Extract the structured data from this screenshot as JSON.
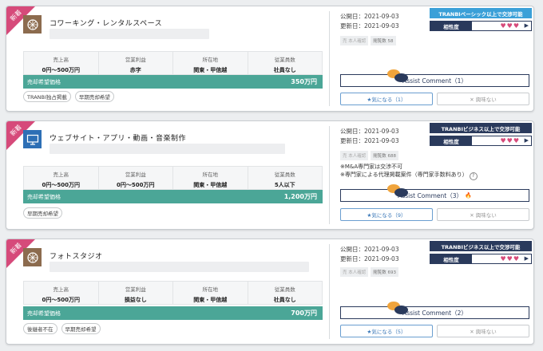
{
  "colors": {
    "new_ribbon": "#d64a7a",
    "price_bar": "#4ba697",
    "navy": "#2a3a5c",
    "basic_badge": "#3aa0d8",
    "fav_blue": "#3b78b8"
  },
  "listings": [
    {
      "ribbon": "新着",
      "icon": "coworking-icon",
      "title": "コワーキング・レンタルスペース",
      "stats": [
        {
          "label": "売上高",
          "value": "0円〜500万円"
        },
        {
          "label": "営業利益",
          "value": "赤字"
        },
        {
          "label": "所在地",
          "value": "関東・甲信越"
        },
        {
          "label": "従業員数",
          "value": "社員なし"
        }
      ],
      "price_label": "売却希望価格",
      "price_value": "350万円",
      "tags": [
        "TRANBI独占掲載",
        "早期売却希望"
      ],
      "published": "公開日：2021-09-03",
      "updated": "更新日：2021-09-03",
      "plan_badge": "TRANBIベーシック以上で交渉可能",
      "compat_label": "相性度",
      "compat_hearts": "♥♥♥",
      "mini_tags": [
        "売 本人確認",
        "閲覧数 58"
      ],
      "notes": [],
      "assist_label": "Assist Comment",
      "assist_count": "（1）",
      "assist_hot": false,
      "fav_label": "★気になる（1）",
      "no_label": "✕ 興味ない"
    },
    {
      "ribbon": "新着",
      "icon": "monitor-icon",
      "title": "ウェブサイト・アプリ・動画・音楽制作",
      "stats": [
        {
          "label": "売上高",
          "value": "0円〜500万円"
        },
        {
          "label": "営業利益",
          "value": "0円〜500万円"
        },
        {
          "label": "所在地",
          "value": "関東・甲信越"
        },
        {
          "label": "従業員数",
          "value": "5人以下"
        }
      ],
      "price_label": "売却希望価格",
      "price_value": "1,200万円",
      "tags": [
        "早期売却希望"
      ],
      "published": "公開日：2021-09-03",
      "updated": "更新日：2021-09-03",
      "plan_badge": "TRANBIビジネス以上で交渉可能",
      "compat_label": "相性度",
      "compat_hearts": "♥♥♥",
      "mini_tags": [
        "売 本人確認",
        "閲覧数 688"
      ],
      "notes": [
        "※M&A専門家は交渉不可",
        "※専門家による代理掲載案件（専門家手数料あり）"
      ],
      "assist_label": "Assist Comment",
      "assist_count": "（3）",
      "assist_hot": true,
      "fav_label": "★気になる（9）",
      "no_label": "✕ 興味ない"
    },
    {
      "ribbon": "新着",
      "icon": "photo-studio-icon",
      "title": "フォトスタジオ",
      "stats": [
        {
          "label": "売上高",
          "value": "0円〜500万円"
        },
        {
          "label": "営業利益",
          "value": "損益なし"
        },
        {
          "label": "所在地",
          "value": "関東・甲信越"
        },
        {
          "label": "従業員数",
          "value": "社員なし"
        }
      ],
      "price_label": "売却希望価格",
      "price_value": "700万円",
      "tags": [
        "後継者不在",
        "早期売却希望"
      ],
      "published": "公開日：2021-09-03",
      "updated": "更新日：2021-09-03",
      "plan_badge": "TRANBIビジネス以上で交渉可能",
      "compat_label": "相性度",
      "compat_hearts": "♥♥♥",
      "mini_tags": [
        "売 本人確認",
        "閲覧数 693"
      ],
      "notes": [],
      "assist_label": "Assist Comment",
      "assist_count": "（2）",
      "assist_hot": false,
      "fav_label": "★気になる（5）",
      "no_label": "✕ 興味ない"
    }
  ]
}
